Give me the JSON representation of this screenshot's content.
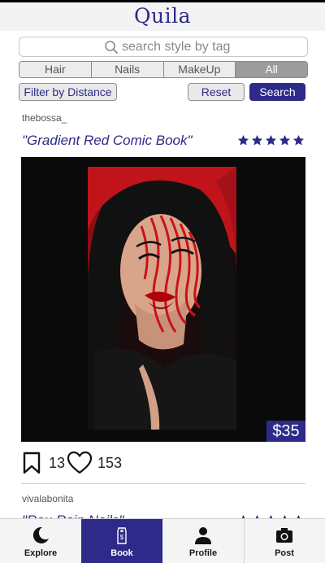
{
  "header": {
    "logo": "Quila"
  },
  "search": {
    "placeholder": "search style by tag"
  },
  "filters": {
    "segments": [
      "Hair",
      "Nails",
      "MakeUp",
      "All"
    ],
    "active": "All",
    "filter_distance_label": "Filter by Distance",
    "reset_label": "Reset",
    "search_label": "Search"
  },
  "post1": {
    "username": "thebossa_",
    "title": "\"Gradient Red Comic Book\"",
    "rating": 5,
    "price": "$35",
    "saves": "13",
    "likes": "153"
  },
  "post2": {
    "username": "vivalabonita",
    "title_partial": "\"Rou Rain Nails\""
  },
  "tabs": [
    {
      "label": "Explore",
      "icon": "moon-icon"
    },
    {
      "label": "Book",
      "icon": "price-tag-icon"
    },
    {
      "label": "Profile",
      "icon": "person-icon"
    },
    {
      "label": "Post",
      "icon": "camera-icon"
    }
  ],
  "colors": {
    "brand": "#2e2a8a",
    "segment_active": "#9c9c9c"
  }
}
